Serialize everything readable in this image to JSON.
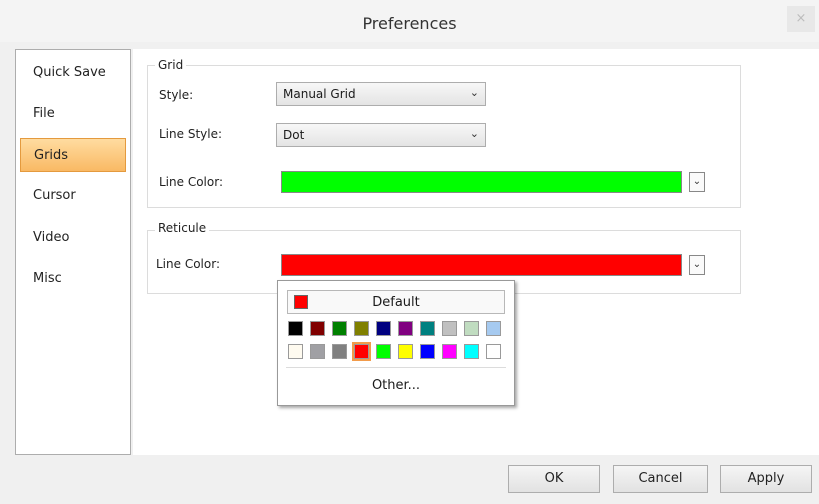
{
  "window": {
    "title": "Preferences",
    "close_glyph": "×"
  },
  "sidebar": {
    "items": [
      {
        "label": "Quick Save"
      },
      {
        "label": "File"
      },
      {
        "label": "Grids"
      },
      {
        "label": "Cursor"
      },
      {
        "label": "Video"
      },
      {
        "label": "Misc"
      }
    ],
    "selected": "Grids"
  },
  "grid": {
    "title": "Grid",
    "style_label": "Style:",
    "style_value": "Manual Grid",
    "line_style_label": "Line Style:",
    "line_style_value": "Dot",
    "line_color_label": "Line Color:",
    "line_color": "#00ff00"
  },
  "reticule": {
    "title": "Reticule",
    "line_color_label": "Line Color:",
    "line_color": "#ff0000"
  },
  "color_popup": {
    "default_label": "Default",
    "default_color": "#ff0000",
    "row1": [
      "#000000",
      "#800000",
      "#008000",
      "#808000",
      "#000080",
      "#800080",
      "#008080",
      "#c0c0c0",
      "#c0dcc0",
      "#a6caf0"
    ],
    "row2": [
      "#fffbf0",
      "#a0a0a4",
      "#808080",
      "#ff0000",
      "#00ff00",
      "#ffff00",
      "#0000ff",
      "#ff00ff",
      "#00ffff",
      "#ffffff"
    ],
    "selected_row2_index": 3,
    "other_label": "Other..."
  },
  "buttons": {
    "ok": "OK",
    "cancel": "Cancel",
    "apply": "Apply"
  },
  "icons": {
    "dropdown": "chevron-down-icon",
    "close": "close-icon"
  }
}
